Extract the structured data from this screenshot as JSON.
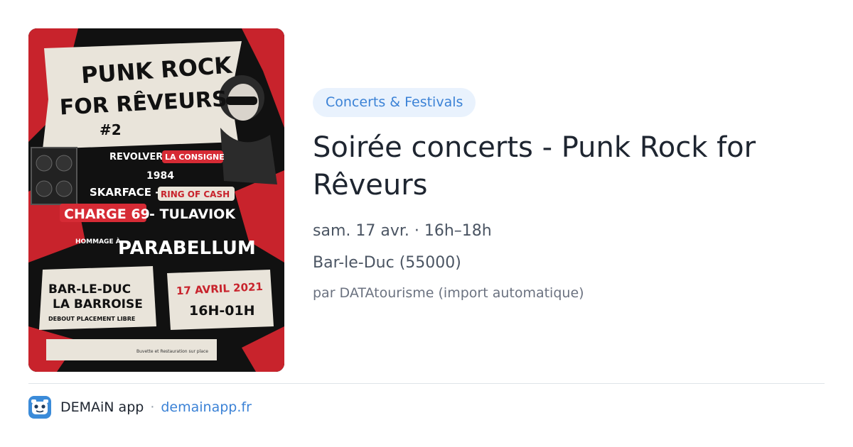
{
  "poster": {
    "title_line1": "PUNK ROCK",
    "title_line2": "FOR RÊVEURS",
    "edition": "#2",
    "band1": "REVOLVER -",
    "band2": "LA CONSIGNE",
    "band3": "1984",
    "band4": "SKARFACE -",
    "band5": "RING OF CASH",
    "band6": "CHARGE 69",
    "band7": "- TULAVIOK",
    "tribute_prefix": "HOMMAGE À",
    "tribute": "PARABELLUM",
    "venue_city": "BAR-LE-DUC",
    "venue_name": "LA BARROISE",
    "venue_note": "DEBOUT PLACEMENT LIBRE",
    "date": "17 AVRIL 2021",
    "hours": "16H-01H",
    "footer_note": "Buvette et Restauration sur place"
  },
  "event": {
    "category": "Concerts & Festivals",
    "title": "Soirée concerts - Punk Rock for Rêveurs",
    "when": "sam. 17 avr. · 16h–18h",
    "where": "Bar-le-Duc (55000)",
    "source": "par DATAtourisme (import automatique)"
  },
  "footer": {
    "app_name": "DEMAiN app",
    "separator": "·",
    "app_url": "demainapp.fr",
    "icon": "demain-app-logo-icon"
  },
  "colors": {
    "accent": "#3b82d6",
    "badge_bg": "#e9f2fd",
    "poster_red": "#c8232c"
  }
}
